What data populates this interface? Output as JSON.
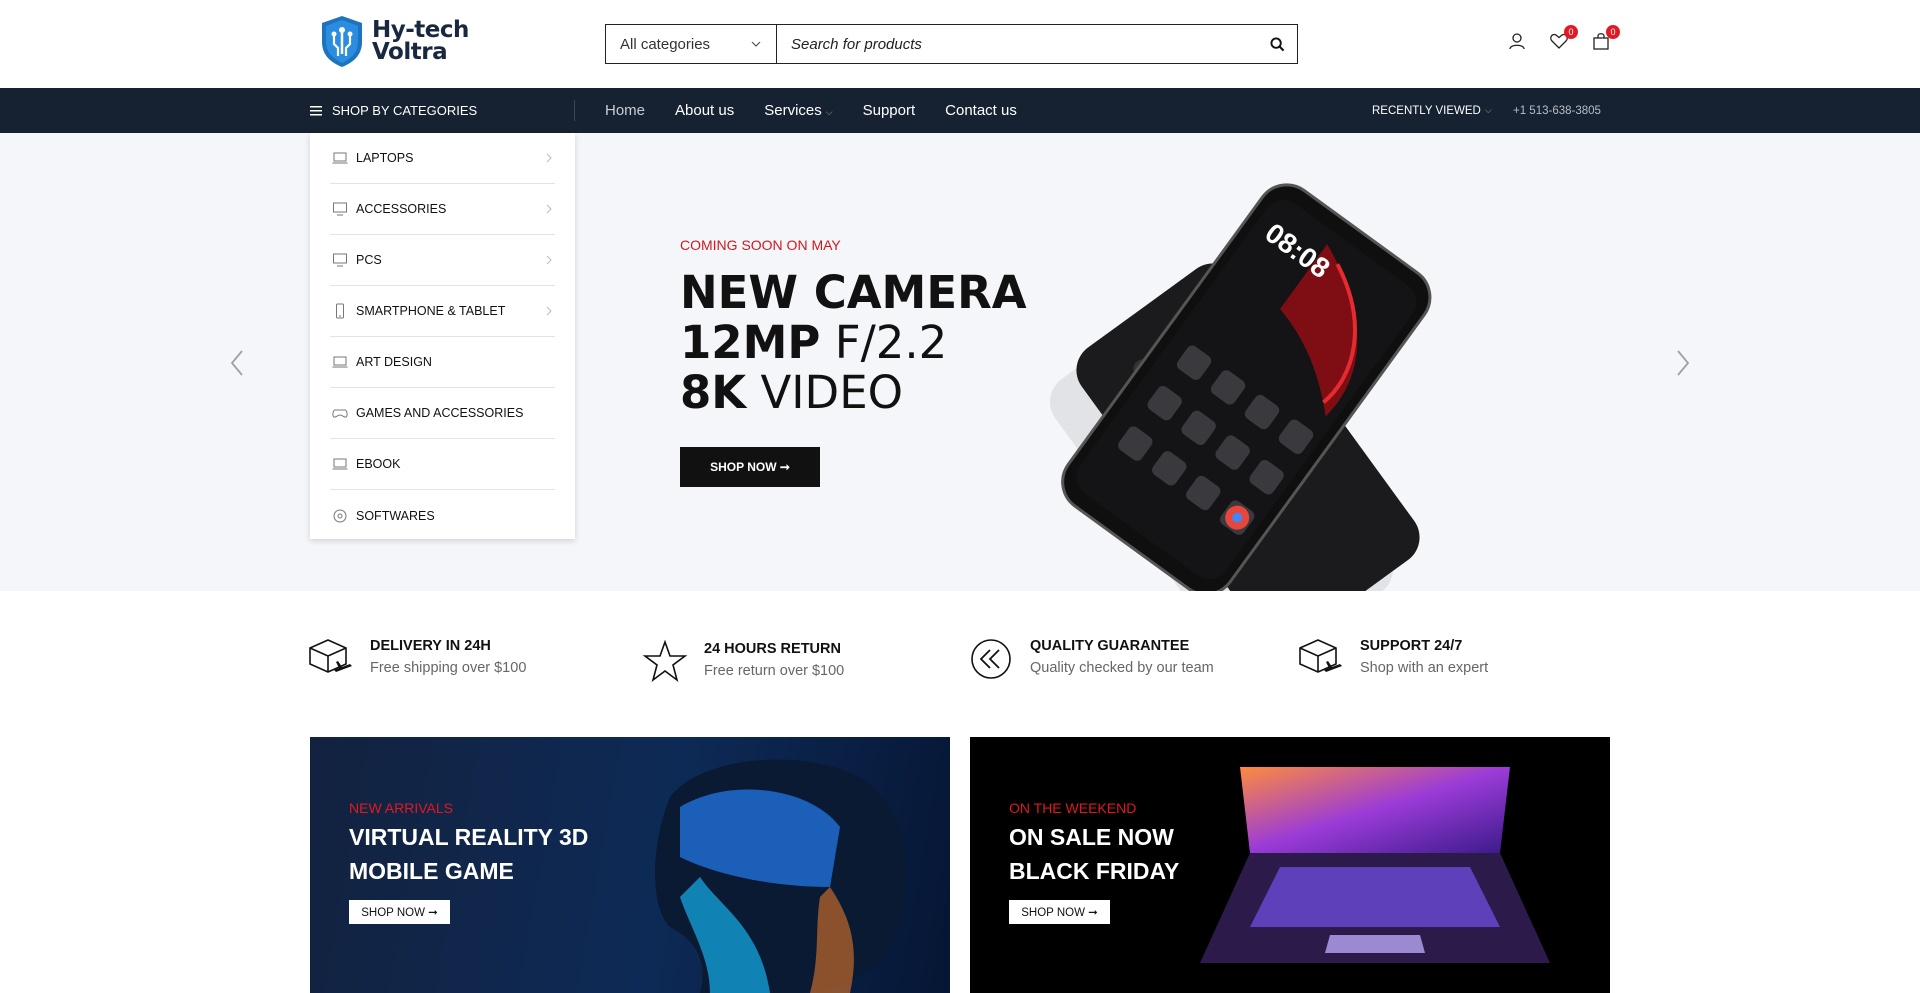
{
  "brand": {
    "line1": "Hy-tech",
    "line2": "Voltra"
  },
  "search": {
    "category": "All categories",
    "placeholder": "Search for products"
  },
  "header_icons": {
    "wishlist_count": "0",
    "cart_count": "0"
  },
  "nav": {
    "shop_by": "SHOP BY CATEGORIES",
    "links": [
      "Home",
      "About us",
      "Services",
      "Support",
      "Contact us"
    ],
    "recently_viewed": "RECENTLY VIEWED",
    "phone": "+1 513-638-3805"
  },
  "categories": [
    {
      "label": "LAPTOPS",
      "icon": "laptop-icon"
    },
    {
      "label": "ACCESSORIES",
      "icon": "monitor-icon"
    },
    {
      "label": "PCS",
      "icon": "monitor-icon"
    },
    {
      "label": "SMARTPHONE & TABLET",
      "icon": "smartphone-icon"
    },
    {
      "label": "ART DESIGN",
      "icon": "laptop-icon"
    },
    {
      "label": "GAMES AND ACCESSORIES",
      "icon": "gamepad-icon"
    },
    {
      "label": "EBOOK",
      "icon": "laptop-icon"
    },
    {
      "label": "SOFTWARES",
      "icon": "software-icon"
    }
  ],
  "hero": {
    "eyebrow": "COMING SOON ON MAY",
    "line1": "NEW CAMERA",
    "line2_bold": "12MP",
    "line2_thin": " F/2.2",
    "line3_bold": "8K",
    "line3_thin": " VIDEO",
    "button": "SHOP NOW ➞"
  },
  "features": [
    {
      "title": "DELIVERY IN 24H",
      "sub": "Free shipping over $100",
      "icon": "delivery-box-icon"
    },
    {
      "title": "24 HOURS RETURN",
      "sub": "Free return over $100",
      "icon": "star-icon"
    },
    {
      "title": "QUALITY GUARANTEE",
      "sub": "Quality checked by our team",
      "icon": "rewind-circle-icon"
    },
    {
      "title": "SUPPORT 24/7",
      "sub": "Shop with an expert",
      "icon": "delivery-box-icon"
    }
  ],
  "banners": [
    {
      "eyebrow": "NEW ARRIVALS",
      "line1": "VIRTUAL REALITY 3D",
      "line2": "MOBILE GAME",
      "button": "SHOP NOW ➞"
    },
    {
      "eyebrow": "ON THE WEEKEND",
      "line1": "ON SALE NOW",
      "line2": "BLACK FRIDAY",
      "button": "SHOP NOW ➞"
    }
  ],
  "colors": {
    "navy": "#162132",
    "accent_red": "#d0191f",
    "hero_bg": "#f4f6f9"
  }
}
